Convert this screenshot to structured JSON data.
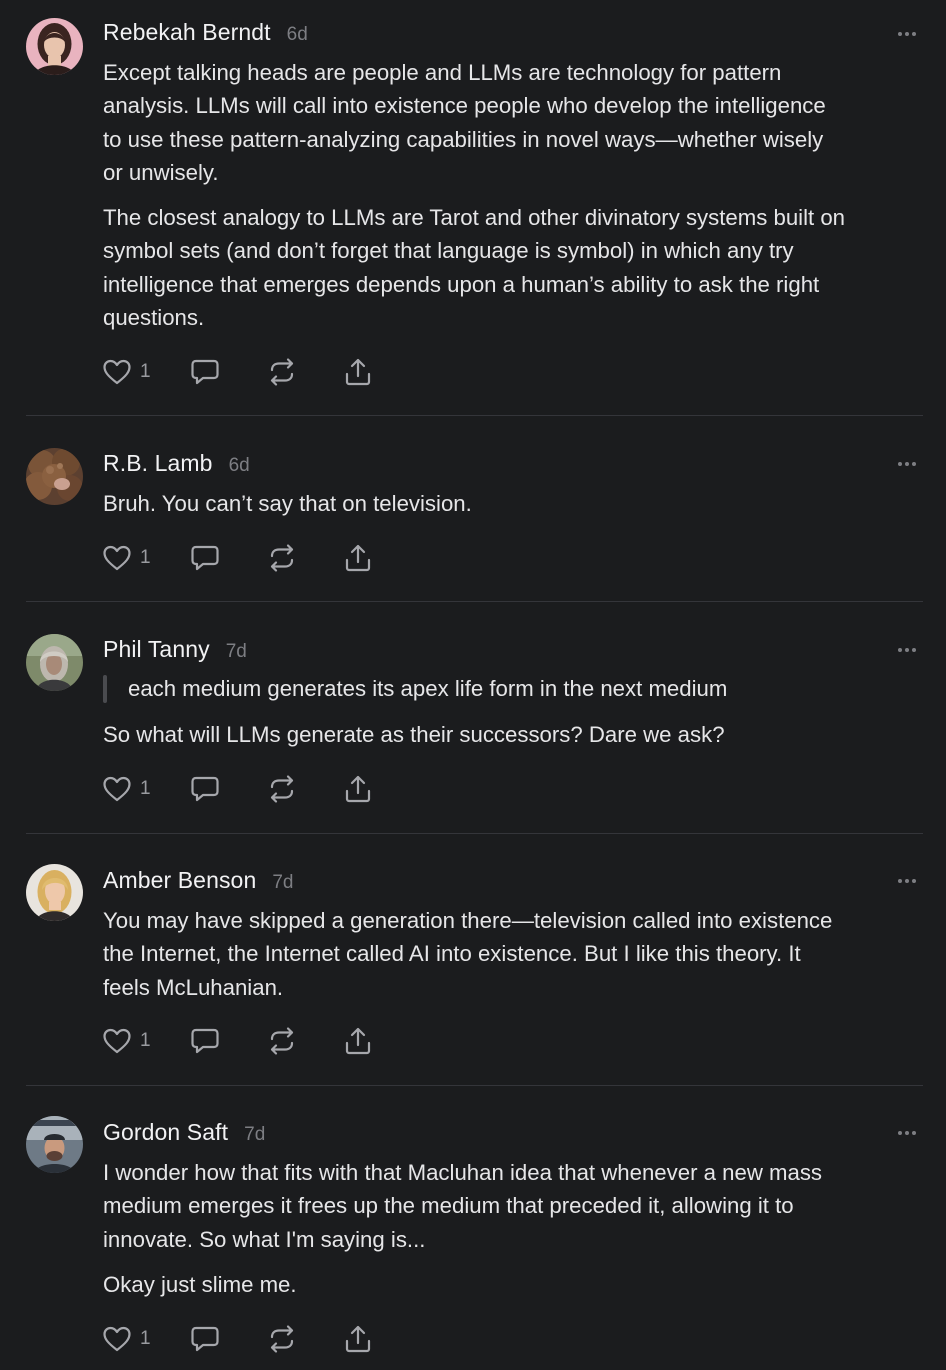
{
  "comments": [
    {
      "author": "Rebekah Berndt",
      "time": "6d",
      "paragraphs": [
        [
          "Except talking heads are people and LLMs are technology for pattern",
          "analysis. LLMs will call into existence people who develop the intelligence",
          "to use these pattern-analyzing capabilities in novel ways—whether wisely",
          "or unwisely."
        ],
        [
          "The closest analogy to LLMs are Tarot and other divinatory systems built on",
          "symbol sets (and don’t forget that language is symbol) in which any try",
          "intelligence that emerges depends upon a human’s ability to ask the right",
          "questions."
        ]
      ],
      "likes": "1"
    },
    {
      "author": "R.B. Lamb",
      "time": "6d",
      "paragraphs": [
        [
          "Bruh. You can’t say that on television."
        ]
      ],
      "likes": "1"
    },
    {
      "author": "Phil Tanny",
      "time": "7d",
      "quote": "each medium generates its apex life form in the next medium",
      "paragraphs": [
        [
          "So what will LLMs generate as their successors? Dare we ask?"
        ]
      ],
      "likes": "1"
    },
    {
      "author": "Amber Benson",
      "time": "7d",
      "paragraphs": [
        [
          "You may have skipped a generation there—television called into existence",
          "the Internet, the Internet called AI into existence. But I like this theory. It",
          "feels McLuhanian."
        ]
      ],
      "likes": "1"
    },
    {
      "author": "Gordon Saft",
      "time": "7d",
      "paragraphs": [
        [
          "I wonder how that fits with that Macluhan idea that whenever a new mass",
          "medium emerges it frees up the medium that preceded it, allowing it to",
          "innovate. So what I'm saying is..."
        ],
        [
          "Okay just slime me."
        ]
      ],
      "likes": "1"
    }
  ],
  "icons": {
    "like": "heart-icon",
    "reply": "comment-bubble-icon",
    "restack": "restack-icon",
    "share": "share-icon",
    "more": "more-dots-icon"
  },
  "colors": {
    "background": "#1b1c1e",
    "text": "#e6e6e8",
    "muted": "#7d7e83",
    "divider": "#34353a"
  }
}
